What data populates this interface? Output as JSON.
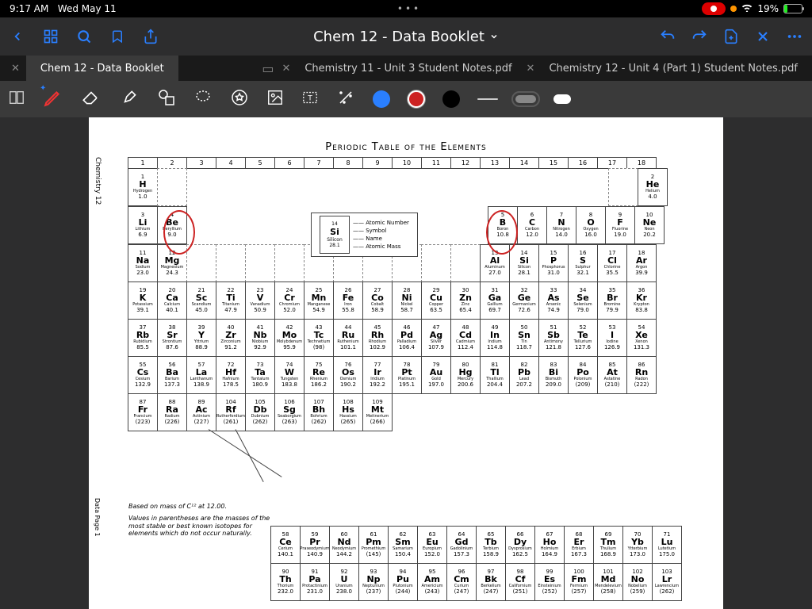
{
  "status": {
    "time": "9:17 AM",
    "date": "Wed May 11",
    "battery": "19%",
    "battery_fill": "19%"
  },
  "header": {
    "title": "Chem 12 - Data Booklet"
  },
  "tabs": [
    {
      "label": "Chem 12 - Data Booklet",
      "active": true
    },
    {
      "label": "Chemistry 11 - Unit 3 Student Notes.pdf",
      "active": false
    },
    {
      "label": "Chemistry 12 - Unit 4 (Part 1) Student Notes.pdf",
      "active": false
    }
  ],
  "doc": {
    "side_label": "Chemistry 12",
    "side_label2": "Data Page 1",
    "title": "Periodic Table of the Elements",
    "groups": [
      "1",
      "2",
      "3",
      "4",
      "5",
      "6",
      "7",
      "8",
      "9",
      "10",
      "11",
      "12",
      "13",
      "14",
      "15",
      "16",
      "17",
      "18"
    ],
    "legend": {
      "num": "14",
      "sym": "Si",
      "name": "Silicon",
      "mass": "28.1",
      "labels": [
        "Atomic Number",
        "Symbol",
        "Name",
        "Atomic Mass"
      ]
    },
    "notes_line1": "Based on mass of C¹² at 12.00.",
    "notes_line2": "Values in parentheses are the masses of the most stable or best known isotopes for elements which do not occur naturally.",
    "elements": {
      "H": {
        "n": "1",
        "s": "H",
        "nm": "Hydrogen",
        "m": "1.0"
      },
      "He": {
        "n": "2",
        "s": "He",
        "nm": "Helium",
        "m": "4.0"
      },
      "Li": {
        "n": "3",
        "s": "Li",
        "nm": "Lithium",
        "m": "6.9"
      },
      "Be": {
        "n": "4",
        "s": "Be",
        "nm": "Beryllium",
        "m": "9.0"
      },
      "B": {
        "n": "5",
        "s": "B",
        "nm": "Boron",
        "m": "10.8"
      },
      "C": {
        "n": "6",
        "s": "C",
        "nm": "Carbon",
        "m": "12.0"
      },
      "N": {
        "n": "7",
        "s": "N",
        "nm": "Nitrogen",
        "m": "14.0"
      },
      "O": {
        "n": "8",
        "s": "O",
        "nm": "Oxygen",
        "m": "16.0"
      },
      "F": {
        "n": "9",
        "s": "F",
        "nm": "Fluorine",
        "m": "19.0"
      },
      "Ne": {
        "n": "10",
        "s": "Ne",
        "nm": "Neon",
        "m": "20.2"
      },
      "Na": {
        "n": "11",
        "s": "Na",
        "nm": "Sodium",
        "m": "23.0"
      },
      "Mg": {
        "n": "12",
        "s": "Mg",
        "nm": "Magnesium",
        "m": "24.3"
      },
      "Al": {
        "n": "13",
        "s": "Al",
        "nm": "Aluminum",
        "m": "27.0"
      },
      "Si": {
        "n": "14",
        "s": "Si",
        "nm": "Silicon",
        "m": "28.1"
      },
      "P": {
        "n": "15",
        "s": "P",
        "nm": "Phosphorus",
        "m": "31.0"
      },
      "S": {
        "n": "16",
        "s": "S",
        "nm": "Sulphur",
        "m": "32.1"
      },
      "Cl": {
        "n": "17",
        "s": "Cl",
        "nm": "Chlorine",
        "m": "35.5"
      },
      "Ar": {
        "n": "18",
        "s": "Ar",
        "nm": "Argon",
        "m": "39.9"
      },
      "K": {
        "n": "19",
        "s": "K",
        "nm": "Potassium",
        "m": "39.1"
      },
      "Ca": {
        "n": "20",
        "s": "Ca",
        "nm": "Calcium",
        "m": "40.1"
      },
      "Sc": {
        "n": "21",
        "s": "Sc",
        "nm": "Scandium",
        "m": "45.0"
      },
      "Ti": {
        "n": "22",
        "s": "Ti",
        "nm": "Titanium",
        "m": "47.9"
      },
      "V": {
        "n": "23",
        "s": "V",
        "nm": "Vanadium",
        "m": "50.9"
      },
      "Cr": {
        "n": "24",
        "s": "Cr",
        "nm": "Chromium",
        "m": "52.0"
      },
      "Mn": {
        "n": "25",
        "s": "Mn",
        "nm": "Manganese",
        "m": "54.9"
      },
      "Fe": {
        "n": "26",
        "s": "Fe",
        "nm": "Iron",
        "m": "55.8"
      },
      "Co": {
        "n": "27",
        "s": "Co",
        "nm": "Cobalt",
        "m": "58.9"
      },
      "Ni": {
        "n": "28",
        "s": "Ni",
        "nm": "Nickel",
        "m": "58.7"
      },
      "Cu": {
        "n": "29",
        "s": "Cu",
        "nm": "Copper",
        "m": "63.5"
      },
      "Zn": {
        "n": "30",
        "s": "Zn",
        "nm": "Zinc",
        "m": "65.4"
      },
      "Ga": {
        "n": "31",
        "s": "Ga",
        "nm": "Gallium",
        "m": "69.7"
      },
      "Ge": {
        "n": "32",
        "s": "Ge",
        "nm": "Germanium",
        "m": "72.6"
      },
      "As": {
        "n": "33",
        "s": "As",
        "nm": "Arsenic",
        "m": "74.9"
      },
      "Se": {
        "n": "34",
        "s": "Se",
        "nm": "Selenium",
        "m": "79.0"
      },
      "Br": {
        "n": "35",
        "s": "Br",
        "nm": "Bromine",
        "m": "79.9"
      },
      "Kr": {
        "n": "36",
        "s": "Kr",
        "nm": "Krypton",
        "m": "83.8"
      },
      "Rb": {
        "n": "37",
        "s": "Rb",
        "nm": "Rubidium",
        "m": "85.5"
      },
      "Sr": {
        "n": "38",
        "s": "Sr",
        "nm": "Strontium",
        "m": "87.6"
      },
      "Y": {
        "n": "39",
        "s": "Y",
        "nm": "Yttrium",
        "m": "88.9"
      },
      "Zr": {
        "n": "40",
        "s": "Zr",
        "nm": "Zirconium",
        "m": "91.2"
      },
      "Nb": {
        "n": "41",
        "s": "Nb",
        "nm": "Niobium",
        "m": "92.9"
      },
      "Mo": {
        "n": "42",
        "s": "Mo",
        "nm": "Molybdenum",
        "m": "95.9"
      },
      "Tc": {
        "n": "43",
        "s": "Tc",
        "nm": "Technetium",
        "m": "(98)"
      },
      "Ru": {
        "n": "44",
        "s": "Ru",
        "nm": "Ruthenium",
        "m": "101.1"
      },
      "Rh": {
        "n": "45",
        "s": "Rh",
        "nm": "Rhodium",
        "m": "102.9"
      },
      "Pd": {
        "n": "46",
        "s": "Pd",
        "nm": "Palladium",
        "m": "106.4"
      },
      "Ag": {
        "n": "47",
        "s": "Ag",
        "nm": "Silver",
        "m": "107.9"
      },
      "Cd": {
        "n": "48",
        "s": "Cd",
        "nm": "Cadmium",
        "m": "112.4"
      },
      "In": {
        "n": "49",
        "s": "In",
        "nm": "Indium",
        "m": "114.8"
      },
      "Sn": {
        "n": "50",
        "s": "Sn",
        "nm": "Tin",
        "m": "118.7"
      },
      "Sb": {
        "n": "51",
        "s": "Sb",
        "nm": "Antimony",
        "m": "121.8"
      },
      "Te": {
        "n": "52",
        "s": "Te",
        "nm": "Tellurium",
        "m": "127.6"
      },
      "I": {
        "n": "53",
        "s": "I",
        "nm": "Iodine",
        "m": "126.9"
      },
      "Xe": {
        "n": "54",
        "s": "Xe",
        "nm": "Xenon",
        "m": "131.3"
      },
      "Cs": {
        "n": "55",
        "s": "Cs",
        "nm": "Cesium",
        "m": "132.9"
      },
      "Ba": {
        "n": "56",
        "s": "Ba",
        "nm": "Barium",
        "m": "137.3"
      },
      "La": {
        "n": "57",
        "s": "La",
        "nm": "Lanthanum",
        "m": "138.9"
      },
      "Hf": {
        "n": "72",
        "s": "Hf",
        "nm": "Hafnium",
        "m": "178.5"
      },
      "Ta": {
        "n": "73",
        "s": "Ta",
        "nm": "Tantalum",
        "m": "180.9"
      },
      "W": {
        "n": "74",
        "s": "W",
        "nm": "Tungsten",
        "m": "183.8"
      },
      "Re": {
        "n": "75",
        "s": "Re",
        "nm": "Rhenium",
        "m": "186.2"
      },
      "Os": {
        "n": "76",
        "s": "Os",
        "nm": "Osmium",
        "m": "190.2"
      },
      "Ir": {
        "n": "77",
        "s": "Ir",
        "nm": "Iridium",
        "m": "192.2"
      },
      "Pt": {
        "n": "78",
        "s": "Pt",
        "nm": "Platinum",
        "m": "195.1"
      },
      "Au": {
        "n": "79",
        "s": "Au",
        "nm": "Gold",
        "m": "197.0"
      },
      "Hg": {
        "n": "80",
        "s": "Hg",
        "nm": "Mercury",
        "m": "200.6"
      },
      "Tl": {
        "n": "81",
        "s": "Tl",
        "nm": "Thallium",
        "m": "204.4"
      },
      "Pb": {
        "n": "82",
        "s": "Pb",
        "nm": "Lead",
        "m": "207.2"
      },
      "Bi": {
        "n": "83",
        "s": "Bi",
        "nm": "Bismuth",
        "m": "209.0"
      },
      "Po": {
        "n": "84",
        "s": "Po",
        "nm": "Polonium",
        "m": "(209)"
      },
      "At": {
        "n": "85",
        "s": "At",
        "nm": "Astatine",
        "m": "(210)"
      },
      "Rn": {
        "n": "86",
        "s": "Rn",
        "nm": "Radon",
        "m": "(222)"
      },
      "Fr": {
        "n": "87",
        "s": "Fr",
        "nm": "Francium",
        "m": "(223)"
      },
      "Ra": {
        "n": "88",
        "s": "Ra",
        "nm": "Radium",
        "m": "(226)"
      },
      "Ac": {
        "n": "89",
        "s": "Ac",
        "nm": "Actinium",
        "m": "(227)"
      },
      "Rf": {
        "n": "104",
        "s": "Rf",
        "nm": "Rutherfordium",
        "m": "(261)"
      },
      "Db": {
        "n": "105",
        "s": "Db",
        "nm": "Dubnium",
        "m": "(262)"
      },
      "Sg": {
        "n": "106",
        "s": "Sg",
        "nm": "Seaborgium",
        "m": "(263)"
      },
      "Bh": {
        "n": "107",
        "s": "Bh",
        "nm": "Bohrium",
        "m": "(262)"
      },
      "Hs": {
        "n": "108",
        "s": "Hs",
        "nm": "Hassium",
        "m": "(265)"
      },
      "Mt": {
        "n": "109",
        "s": "Mt",
        "nm": "Meitnerium",
        "m": "(266)"
      },
      "Ce": {
        "n": "58",
        "s": "Ce",
        "nm": "Cerium",
        "m": "140.1"
      },
      "Pr": {
        "n": "59",
        "s": "Pr",
        "nm": "Praseodymium",
        "m": "140.9"
      },
      "Nd": {
        "n": "60",
        "s": "Nd",
        "nm": "Neodymium",
        "m": "144.2"
      },
      "Pm": {
        "n": "61",
        "s": "Pm",
        "nm": "Promethium",
        "m": "(145)"
      },
      "Sm": {
        "n": "62",
        "s": "Sm",
        "nm": "Samarium",
        "m": "150.4"
      },
      "Eu": {
        "n": "63",
        "s": "Eu",
        "nm": "Europium",
        "m": "152.0"
      },
      "Gd": {
        "n": "64",
        "s": "Gd",
        "nm": "Gadolinium",
        "m": "157.3"
      },
      "Tb": {
        "n": "65",
        "s": "Tb",
        "nm": "Terbium",
        "m": "158.9"
      },
      "Dy": {
        "n": "66",
        "s": "Dy",
        "nm": "Dysprosium",
        "m": "162.5"
      },
      "Ho": {
        "n": "67",
        "s": "Ho",
        "nm": "Holmium",
        "m": "164.9"
      },
      "Er": {
        "n": "68",
        "s": "Er",
        "nm": "Erbium",
        "m": "167.3"
      },
      "Tm": {
        "n": "69",
        "s": "Tm",
        "nm": "Thulium",
        "m": "168.9"
      },
      "Yb": {
        "n": "70",
        "s": "Yb",
        "nm": "Ytterbium",
        "m": "173.0"
      },
      "Lu": {
        "n": "71",
        "s": "Lu",
        "nm": "Lutetium",
        "m": "175.0"
      },
      "Th": {
        "n": "90",
        "s": "Th",
        "nm": "Thorium",
        "m": "232.0"
      },
      "Pa": {
        "n": "91",
        "s": "Pa",
        "nm": "Protactinium",
        "m": "231.0"
      },
      "U": {
        "n": "92",
        "s": "U",
        "nm": "Uranium",
        "m": "238.0"
      },
      "Np": {
        "n": "93",
        "s": "Np",
        "nm": "Neptunium",
        "m": "(237)"
      },
      "Pu": {
        "n": "94",
        "s": "Pu",
        "nm": "Plutonium",
        "m": "(244)"
      },
      "Am": {
        "n": "95",
        "s": "Am",
        "nm": "Americium",
        "m": "(243)"
      },
      "Cm": {
        "n": "96",
        "s": "Cm",
        "nm": "Curium",
        "m": "(247)"
      },
      "Bk": {
        "n": "97",
        "s": "Bk",
        "nm": "Berkelium",
        "m": "(247)"
      },
      "Cf": {
        "n": "98",
        "s": "Cf",
        "nm": "Californium",
        "m": "(251)"
      },
      "Es": {
        "n": "99",
        "s": "Es",
        "nm": "Einsteinium",
        "m": "(252)"
      },
      "Fm": {
        "n": "100",
        "s": "Fm",
        "nm": "Fermium",
        "m": "(257)"
      },
      "Md": {
        "n": "101",
        "s": "Md",
        "nm": "Mendelevium",
        "m": "(258)"
      },
      "No": {
        "n": "102",
        "s": "No",
        "nm": "Nobelium",
        "m": "(259)"
      },
      "Lr": {
        "n": "103",
        "s": "Lr",
        "nm": "Lawrencium",
        "m": "(262)"
      }
    }
  }
}
